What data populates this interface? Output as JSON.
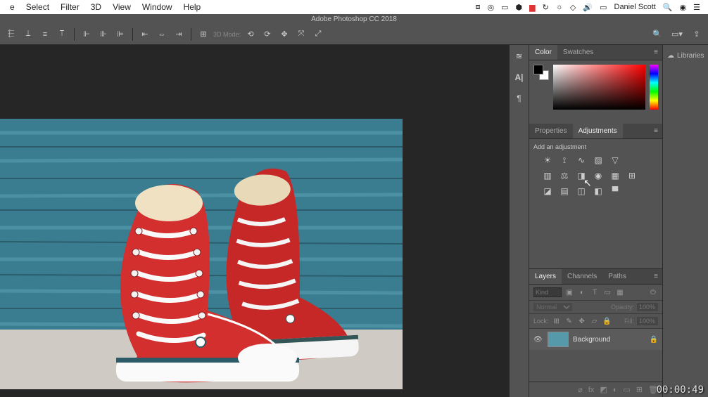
{
  "mac_menu": {
    "items": [
      "e",
      "Select",
      "Filter",
      "3D",
      "View",
      "Window",
      "Help"
    ],
    "user": "Daniel Scott"
  },
  "app": {
    "title": "Adobe Photoshop CC 2018"
  },
  "options_bar": {
    "mode_label": "3D Mode:"
  },
  "panels": {
    "color": {
      "tab1": "Color",
      "tab2": "Swatches"
    },
    "properties_tab": "Properties",
    "adjustments_tab": "Adjustments",
    "adjustments_label": "Add an adjustment",
    "layers": {
      "tab_layers": "Layers",
      "tab_channels": "Channels",
      "tab_paths": "Paths",
      "kind_placeholder": "Kind",
      "blend_mode": "Normal",
      "opacity_label": "Opacity:",
      "opacity_value": "100%",
      "lock_label": "Lock:",
      "fill_label": "Fill:",
      "fill_value": "100%",
      "items": [
        {
          "name": "Background",
          "locked": true
        }
      ]
    },
    "libraries": "Libraries"
  },
  "timecode": "00:00:49"
}
